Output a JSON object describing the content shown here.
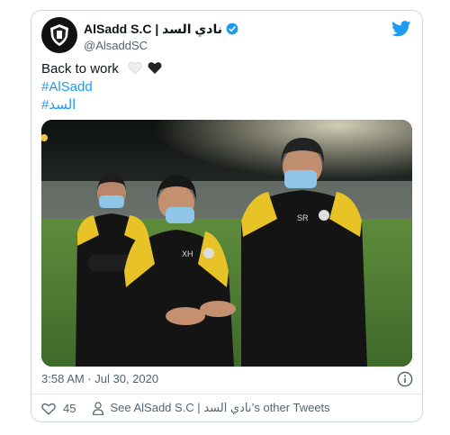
{
  "tweet": {
    "display_name": "AlSadd S.C | نادي السد",
    "handle": "@AlsaddSC",
    "text_line1": "Back to work",
    "hashtag1": "#AlSadd",
    "hashtag2": "#السد",
    "timestamp": "3:58 AM · Jul 30, 2020",
    "like_count": "45",
    "other_tweets_label": "See AlSadd S.C | نادي السد’s other Tweets"
  },
  "colors": {
    "accent": "#1d9bf0",
    "kit_black": "#141414",
    "kit_yellow": "#e8c327",
    "pitch_green": "#4f7a33"
  },
  "icons": [
    "verified-badge-icon",
    "twitter-logo-icon",
    "white-heart-icon",
    "black-heart-icon",
    "info-icon",
    "like-heart-icon",
    "person-icon"
  ],
  "media": {
    "shirt_initials": [
      "XH",
      "SR"
    ]
  }
}
